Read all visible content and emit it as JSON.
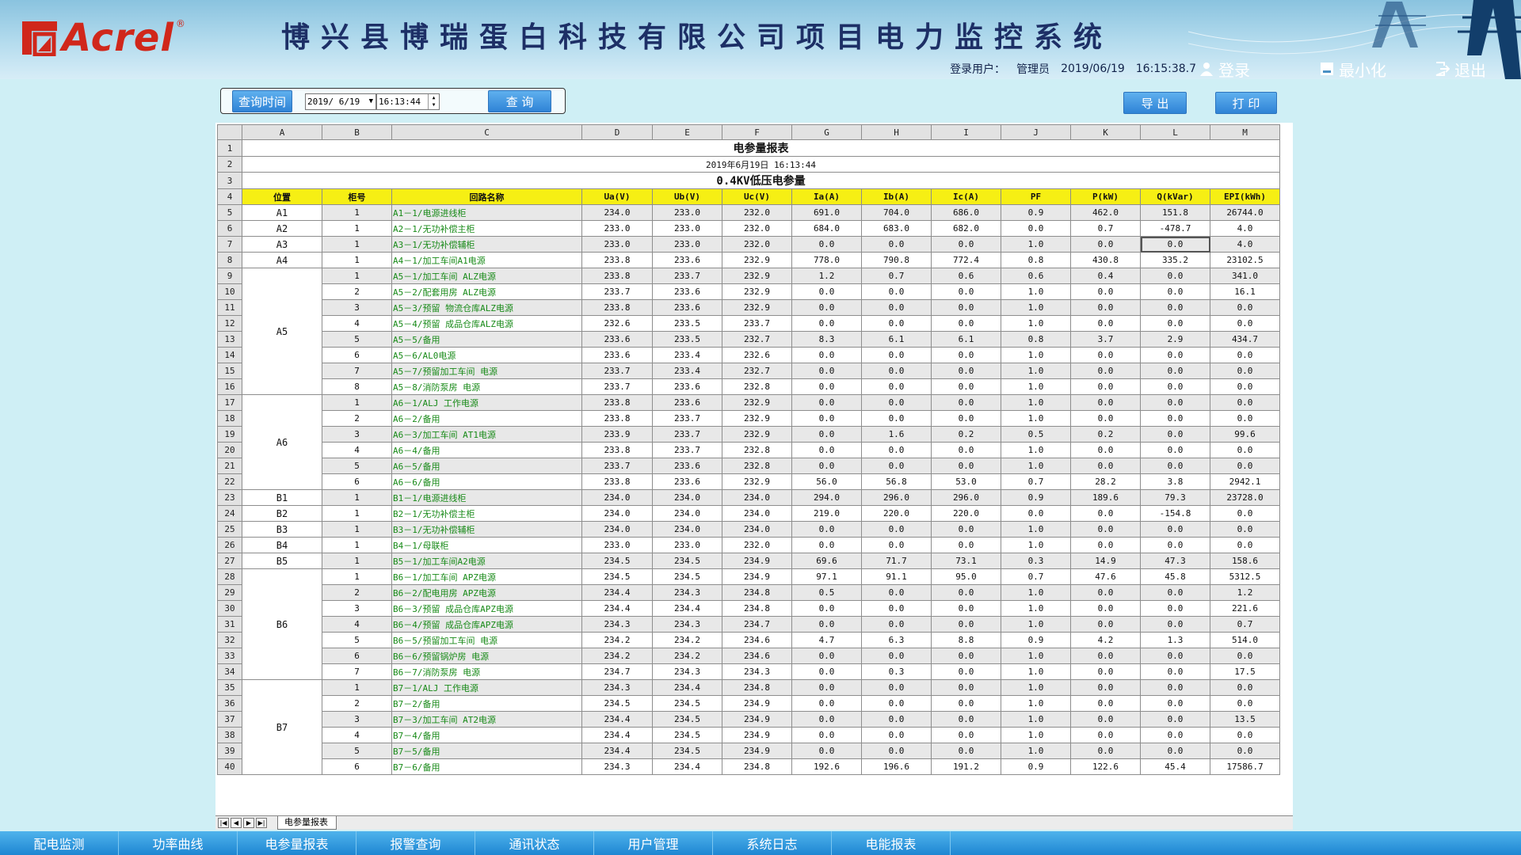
{
  "header": {
    "brand": "Acrel",
    "reg_mark": "®",
    "title": "博兴县博瑞蛋白科技有限公司项目电力监控系统",
    "user_label": "登录用户：",
    "user_name": "管理员",
    "date": "2019/06/19",
    "time": "16:15:38.7",
    "login_label": "登录",
    "minimize_label": "最小化",
    "exit_label": "退出"
  },
  "query": {
    "time_label": "查询时间",
    "date_value": "2019/ 6/19",
    "time_value": "16:13:44",
    "search_label": "查 询",
    "export_label": "导 出",
    "print_label": "打 印"
  },
  "report": {
    "col_letters": [
      "A",
      "B",
      "C",
      "D",
      "E",
      "F",
      "G",
      "H",
      "I",
      "J",
      "K",
      "L",
      "M"
    ],
    "title": "电参量报表",
    "datetime": "2019年6月19日 16:13:44",
    "subtitle": "0.4KV低压电参量",
    "headers": [
      "位置",
      "柜号",
      "回路名称",
      "Ua(V)",
      "Ub(V)",
      "Uc(V)",
      "Ia(A)",
      "Ib(A)",
      "Ic(A)",
      "PF",
      "P(kW)",
      "Q(kVar)",
      "EPI(kWh)"
    ],
    "rows": [
      {
        "r": 5,
        "loc": "A1",
        "span": 1,
        "no": "1",
        "name": "A1－1/电源进线柜",
        "v": [
          "234.0",
          "233.0",
          "232.0",
          "691.0",
          "704.0",
          "686.0",
          "0.9",
          "462.0",
          "151.8",
          "26744.0"
        ]
      },
      {
        "r": 6,
        "loc": "A2",
        "span": 1,
        "no": "1",
        "name": "A2－1/无功补偿主柜",
        "v": [
          "233.0",
          "233.0",
          "232.0",
          "684.0",
          "683.0",
          "682.0",
          "0.0",
          "0.7",
          "-478.7",
          "4.0"
        ]
      },
      {
        "r": 7,
        "loc": "A3",
        "span": 1,
        "no": "1",
        "name": "A3－1/无功补偿辅柜",
        "v": [
          "233.0",
          "233.0",
          "232.0",
          "0.0",
          "0.0",
          "0.0",
          "1.0",
          "0.0",
          "0.0",
          "4.0"
        ]
      },
      {
        "r": 8,
        "loc": "A4",
        "span": 1,
        "no": "1",
        "name": "A4－1/加工车间A1电源",
        "v": [
          "233.8",
          "233.6",
          "232.9",
          "778.0",
          "790.8",
          "772.4",
          "0.8",
          "430.8",
          "335.2",
          "23102.5"
        ]
      },
      {
        "r": 9,
        "loc": "A5",
        "span": 8,
        "no": "1",
        "name": "A5－1/加工车间 ALZ电源",
        "v": [
          "233.8",
          "233.7",
          "232.9",
          "1.2",
          "0.7",
          "0.6",
          "0.6",
          "0.4",
          "0.0",
          "341.0"
        ]
      },
      {
        "r": 10,
        "no": "2",
        "name": "A5－2/配套用房 ALZ电源",
        "v": [
          "233.7",
          "233.6",
          "232.9",
          "0.0",
          "0.0",
          "0.0",
          "1.0",
          "0.0",
          "0.0",
          "16.1"
        ]
      },
      {
        "r": 11,
        "no": "3",
        "name": "A5－3/预留 物流仓库ALZ电源",
        "v": [
          "233.8",
          "233.6",
          "232.9",
          "0.0",
          "0.0",
          "0.0",
          "1.0",
          "0.0",
          "0.0",
          "0.0"
        ]
      },
      {
        "r": 12,
        "no": "4",
        "name": "A5－4/预留 成品仓库ALZ电源",
        "v": [
          "232.6",
          "233.5",
          "233.7",
          "0.0",
          "0.0",
          "0.0",
          "1.0",
          "0.0",
          "0.0",
          "0.0"
        ]
      },
      {
        "r": 13,
        "no": "5",
        "name": "A5－5/备用",
        "v": [
          "233.6",
          "233.5",
          "232.7",
          "8.3",
          "6.1",
          "6.1",
          "0.8",
          "3.7",
          "2.9",
          "434.7"
        ]
      },
      {
        "r": 14,
        "no": "6",
        "name": "A5－6/AL0电源",
        "v": [
          "233.6",
          "233.4",
          "232.6",
          "0.0",
          "0.0",
          "0.0",
          "1.0",
          "0.0",
          "0.0",
          "0.0"
        ]
      },
      {
        "r": 15,
        "no": "7",
        "name": "A5－7/预留加工车间 电源",
        "v": [
          "233.7",
          "233.4",
          "232.7",
          "0.0",
          "0.0",
          "0.0",
          "1.0",
          "0.0",
          "0.0",
          "0.0"
        ]
      },
      {
        "r": 16,
        "no": "8",
        "name": "A5－8/消防泵房 电源",
        "v": [
          "233.7",
          "233.6",
          "232.8",
          "0.0",
          "0.0",
          "0.0",
          "1.0",
          "0.0",
          "0.0",
          "0.0"
        ]
      },
      {
        "r": 17,
        "loc": "A6",
        "span": 6,
        "no": "1",
        "name": "A6－1/ALJ 工作电源",
        "v": [
          "233.8",
          "233.6",
          "232.9",
          "0.0",
          "0.0",
          "0.0",
          "1.0",
          "0.0",
          "0.0",
          "0.0"
        ]
      },
      {
        "r": 18,
        "no": "2",
        "name": "A6－2/备用",
        "v": [
          "233.8",
          "233.7",
          "232.9",
          "0.0",
          "0.0",
          "0.0",
          "1.0",
          "0.0",
          "0.0",
          "0.0"
        ]
      },
      {
        "r": 19,
        "no": "3",
        "name": "A6－3/加工车间 AT1电源",
        "v": [
          "233.9",
          "233.7",
          "232.9",
          "0.0",
          "1.6",
          "0.2",
          "0.5",
          "0.2",
          "0.0",
          "99.6"
        ]
      },
      {
        "r": 20,
        "no": "4",
        "name": "A6－4/备用",
        "v": [
          "233.8",
          "233.7",
          "232.8",
          "0.0",
          "0.0",
          "0.0",
          "1.0",
          "0.0",
          "0.0",
          "0.0"
        ]
      },
      {
        "r": 21,
        "no": "5",
        "name": "A6－5/备用",
        "v": [
          "233.7",
          "233.6",
          "232.8",
          "0.0",
          "0.0",
          "0.0",
          "1.0",
          "0.0",
          "0.0",
          "0.0"
        ]
      },
      {
        "r": 22,
        "no": "6",
        "name": "A6－6/备用",
        "v": [
          "233.8",
          "233.6",
          "232.9",
          "56.0",
          "56.8",
          "53.0",
          "0.7",
          "28.2",
          "3.8",
          "2942.1"
        ]
      },
      {
        "r": 23,
        "loc": "B1",
        "span": 1,
        "no": "1",
        "name": "B1－1/电源进线柜",
        "v": [
          "234.0",
          "234.0",
          "234.0",
          "294.0",
          "296.0",
          "296.0",
          "0.9",
          "189.6",
          "79.3",
          "23728.0"
        ]
      },
      {
        "r": 24,
        "loc": "B2",
        "span": 1,
        "no": "1",
        "name": "B2－1/无功补偿主柜",
        "v": [
          "234.0",
          "234.0",
          "234.0",
          "219.0",
          "220.0",
          "220.0",
          "0.0",
          "0.0",
          "-154.8",
          "0.0"
        ]
      },
      {
        "r": 25,
        "loc": "B3",
        "span": 1,
        "no": "1",
        "name": "B3－1/无功补偿辅柜",
        "v": [
          "234.0",
          "234.0",
          "234.0",
          "0.0",
          "0.0",
          "0.0",
          "1.0",
          "0.0",
          "0.0",
          "0.0"
        ]
      },
      {
        "r": 26,
        "loc": "B4",
        "span": 1,
        "no": "1",
        "name": "B4－1/母联柜",
        "v": [
          "233.0",
          "233.0",
          "232.0",
          "0.0",
          "0.0",
          "0.0",
          "1.0",
          "0.0",
          "0.0",
          "0.0"
        ]
      },
      {
        "r": 27,
        "loc": "B5",
        "span": 1,
        "no": "1",
        "name": "B5－1/加工车间A2电源",
        "v": [
          "234.5",
          "234.5",
          "234.9",
          "69.6",
          "71.7",
          "73.1",
          "0.3",
          "14.9",
          "47.3",
          "158.6"
        ]
      },
      {
        "r": 28,
        "loc": "B6",
        "span": 7,
        "no": "1",
        "name": "B6－1/加工车间 APZ电源",
        "v": [
          "234.5",
          "234.5",
          "234.9",
          "97.1",
          "91.1",
          "95.0",
          "0.7",
          "47.6",
          "45.8",
          "5312.5"
        ]
      },
      {
        "r": 29,
        "no": "2",
        "name": "B6－2/配电用房 APZ电源",
        "v": [
          "234.4",
          "234.3",
          "234.8",
          "0.5",
          "0.0",
          "0.0",
          "1.0",
          "0.0",
          "0.0",
          "1.2"
        ]
      },
      {
        "r": 30,
        "no": "3",
        "name": "B6－3/预留 成品仓库APZ电源",
        "v": [
          "234.4",
          "234.4",
          "234.8",
          "0.0",
          "0.0",
          "0.0",
          "1.0",
          "0.0",
          "0.0",
          "221.6"
        ]
      },
      {
        "r": 31,
        "no": "4",
        "name": "B6－4/预留 成品仓库APZ电源",
        "v": [
          "234.3",
          "234.3",
          "234.7",
          "0.0",
          "0.0",
          "0.0",
          "1.0",
          "0.0",
          "0.0",
          "0.7"
        ]
      },
      {
        "r": 32,
        "no": "5",
        "name": "B6－5/预留加工车间 电源",
        "v": [
          "234.2",
          "234.2",
          "234.6",
          "4.7",
          "6.3",
          "8.8",
          "0.9",
          "4.2",
          "1.3",
          "514.0"
        ]
      },
      {
        "r": 33,
        "no": "6",
        "name": "B6－6/预留锅炉房 电源",
        "v": [
          "234.2",
          "234.2",
          "234.6",
          "0.0",
          "0.0",
          "0.0",
          "1.0",
          "0.0",
          "0.0",
          "0.0"
        ]
      },
      {
        "r": 34,
        "no": "7",
        "name": "B6－7/消防泵房 电源",
        "v": [
          "234.7",
          "234.3",
          "234.3",
          "0.0",
          "0.3",
          "0.0",
          "1.0",
          "0.0",
          "0.0",
          "17.5"
        ]
      },
      {
        "r": 35,
        "loc": "B7",
        "span": 6,
        "no": "1",
        "name": "B7－1/ALJ 工作电源",
        "v": [
          "234.3",
          "234.4",
          "234.8",
          "0.0",
          "0.0",
          "0.0",
          "1.0",
          "0.0",
          "0.0",
          "0.0"
        ]
      },
      {
        "r": 36,
        "no": "2",
        "name": "B7－2/备用",
        "v": [
          "234.5",
          "234.5",
          "234.9",
          "0.0",
          "0.0",
          "0.0",
          "1.0",
          "0.0",
          "0.0",
          "0.0"
        ]
      },
      {
        "r": 37,
        "no": "3",
        "name": "B7－3/加工车间 AT2电源",
        "v": [
          "234.4",
          "234.5",
          "234.9",
          "0.0",
          "0.0",
          "0.0",
          "1.0",
          "0.0",
          "0.0",
          "13.5"
        ]
      },
      {
        "r": 38,
        "no": "4",
        "name": "B7－4/备用",
        "v": [
          "234.4",
          "234.5",
          "234.9",
          "0.0",
          "0.0",
          "0.0",
          "1.0",
          "0.0",
          "0.0",
          "0.0"
        ]
      },
      {
        "r": 39,
        "no": "5",
        "name": "B7－5/备用",
        "v": [
          "234.4",
          "234.5",
          "234.9",
          "0.0",
          "0.0",
          "0.0",
          "1.0",
          "0.0",
          "0.0",
          "0.0"
        ]
      },
      {
        "r": 40,
        "no": "6",
        "name": "B7－6/备用",
        "v": [
          "234.3",
          "234.4",
          "234.8",
          "192.6",
          "196.6",
          "191.2",
          "0.9",
          "122.6",
          "45.4",
          "17586.7"
        ]
      }
    ]
  },
  "sheet_tab": "电参量报表",
  "sheet_nav": [
    "|◀",
    "◀",
    "▶",
    "▶|"
  ],
  "nav": [
    "配电监测",
    "功率曲线",
    "电参量报表",
    "报警查询",
    "通讯状态",
    "用户管理",
    "系统日志",
    "电能报表"
  ]
}
